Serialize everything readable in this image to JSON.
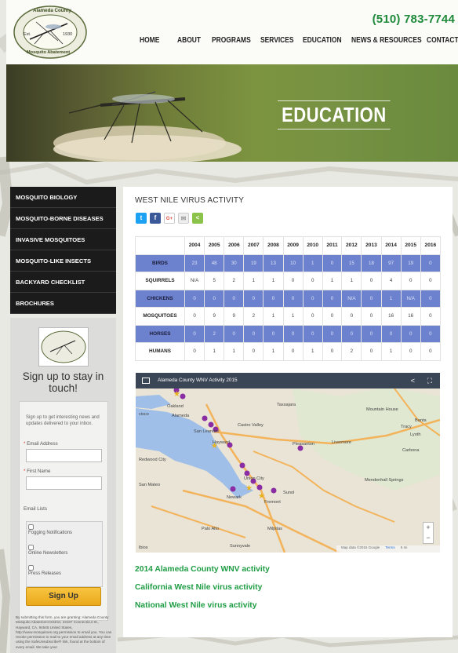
{
  "header": {
    "phone": "(510) 783-7744",
    "logo": {
      "top_text": "Alameda County",
      "bottom_text": "Mosquito Abatement",
      "est": "Est.",
      "year": "1930"
    },
    "nav": [
      "HOME",
      "ABOUT",
      "PROGRAMS",
      "SERVICES",
      "EDUCATION",
      "NEWS & RESOURCES",
      "CONTACT"
    ]
  },
  "hero": {
    "title": "EDUCATION"
  },
  "sidebar": {
    "menu": [
      "MOSQUITO BIOLOGY",
      "MOSQUITO-BORNE DISEASES",
      "INVASIVE MOSQUITOES",
      "MOSQUITO-LIKE INSECTS",
      "BACKYARD CHECKLIST",
      "BROCHURES"
    ],
    "signup": {
      "title": "Sign up to stay in touch!",
      "intro": "Sign up to get interesting news and updates delivered to your inbox.",
      "email_label": "Email Address",
      "first_name_label": "First Name",
      "lists_label": "Email Lists",
      "lists": [
        "Fogging Notifications",
        "Online Newsletters",
        "Press Releases"
      ],
      "button": "Sign Up",
      "privacy": "By submitting this form, you are granting: Alameda County Mosquito Abatement District, 23187 Connecticut St., Hayward, CA, 94545 United States, http://www.mosquitoes.org permission to email you. You can revoke permission to mail to your email address at any time using the SafeUnsubscribe® link, found at the bottom of every email. We take your"
    }
  },
  "main": {
    "heading": "WEST NILE VIRUS ACTIVITY",
    "share_icons": [
      "twitter-icon",
      "facebook-icon",
      "googleplus-icon",
      "email-icon",
      "share-icon"
    ],
    "table": {
      "years": [
        "2004",
        "2005",
        "2006",
        "2007",
        "2008",
        "2009",
        "2010",
        "2011",
        "2012",
        "2013",
        "2014",
        "2015",
        "2016"
      ],
      "rows": [
        {
          "label": "BIRDS",
          "values": [
            "23",
            "48",
            "30",
            "19",
            "13",
            "10",
            "1",
            "0",
            "15",
            "18",
            "97",
            "19",
            "0"
          ],
          "highlight": true
        },
        {
          "label": "SQUIRRELS",
          "values": [
            "N/A",
            "5",
            "2",
            "1",
            "1",
            "0",
            "0",
            "1",
            "1",
            "0",
            "4",
            "0",
            "0"
          ],
          "highlight": false
        },
        {
          "label": "CHICKENS",
          "values": [
            "0",
            "0",
            "0",
            "0",
            "0",
            "0",
            "0",
            "0",
            "N/A",
            "0",
            "1",
            "N/A",
            "0"
          ],
          "highlight": true
        },
        {
          "label": "MOSQUITOES",
          "values": [
            "0",
            "9",
            "9",
            "2",
            "1",
            "1",
            "0",
            "0",
            "0",
            "0",
            "16",
            "16",
            "0"
          ],
          "highlight": false
        },
        {
          "label": "HORSES",
          "values": [
            "0",
            "2",
            "0",
            "0",
            "0",
            "0",
            "0",
            "0",
            "0",
            "0",
            "0",
            "0",
            "0"
          ],
          "highlight": true
        },
        {
          "label": "HUMANS",
          "values": [
            "0",
            "1",
            "1",
            "0",
            "1",
            "0",
            "1",
            "0",
            "2",
            "0",
            "1",
            "0",
            "0"
          ],
          "highlight": false
        }
      ]
    },
    "map": {
      "title": "Alameda County WNV Activity 2015",
      "places": [
        "Oakland",
        "Alameda",
        "San Leandro",
        "Hayward",
        "Castro Valley",
        "Pleasanton",
        "Livermore",
        "Union City",
        "Newark",
        "Fremont",
        "San Mateo",
        "Palo Alto",
        "Milpitas",
        "Sunnyvale",
        "Tracy",
        "Mountain House",
        "Tassajara",
        "Sunol",
        "Mendenhall Springs",
        "Banta",
        "Lyoth",
        "Carbona",
        "Redwood City",
        "cisco",
        "lbios"
      ],
      "attribution": [
        "Map data ©2015 Google",
        "Terms",
        "5 mi"
      ]
    },
    "links": [
      "2014 Alameda County WNV activity",
      "California West Nile virus activity",
      "National West Nile virus activity"
    ]
  },
  "colors": {
    "brand_green": "#1e8a3a",
    "table_highlight": "#6c82cf",
    "signup_button": "#f2b630",
    "sidebar_bg": "#1b1b1b"
  }
}
